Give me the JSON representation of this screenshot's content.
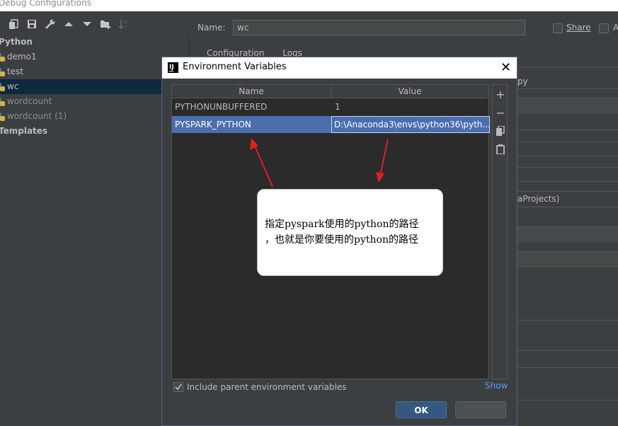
{
  "window_title": "Debug Configurations",
  "toolbar": {
    "icons": [
      "copy-icon",
      "save-icon",
      "wrench-icon",
      "arrow-up-icon",
      "arrow-down-icon",
      "folder-add-icon",
      "sort-icon"
    ]
  },
  "tree": {
    "root_label": "Python",
    "items": [
      "demo1",
      "test",
      "wc",
      "wordcount",
      "wordcount (1)"
    ],
    "selected": "wc",
    "templates_label": "Templates"
  },
  "config": {
    "name_label": "Name:",
    "name_value": "wc",
    "share_label": "Share",
    "allow_label": "A",
    "tab_configuration": "Configuration",
    "tab_logs": "Logs",
    "bg_text_1": "py",
    "bg_text_2": "aProjects)"
  },
  "dialog": {
    "title": "Environment Variables",
    "columns": [
      "Name",
      "Value"
    ],
    "rows": [
      {
        "name": "PYTHONUNBUFFERED",
        "value": "1"
      },
      {
        "name": "PYSPARK_PYTHON",
        "value": "D:\\Anaconda3\\envs\\python36\\pyth..."
      }
    ],
    "side_buttons": [
      "add-icon",
      "remove-icon",
      "copy-icon",
      "paste-icon"
    ],
    "include_parent_label": "Include parent environment variables",
    "include_parent_checked": true,
    "show_link": "Show",
    "ok_label": "OK"
  },
  "callout": {
    "line1": "指定pyspark使用的python的路径",
    "line2": "，也就是你要使用的python的路径"
  },
  "colors": {
    "background": "#3c3f41",
    "selection": "#4b6eaf",
    "tree_selection": "#0d293e",
    "link": "#589df6",
    "arrow": "#e02020"
  }
}
